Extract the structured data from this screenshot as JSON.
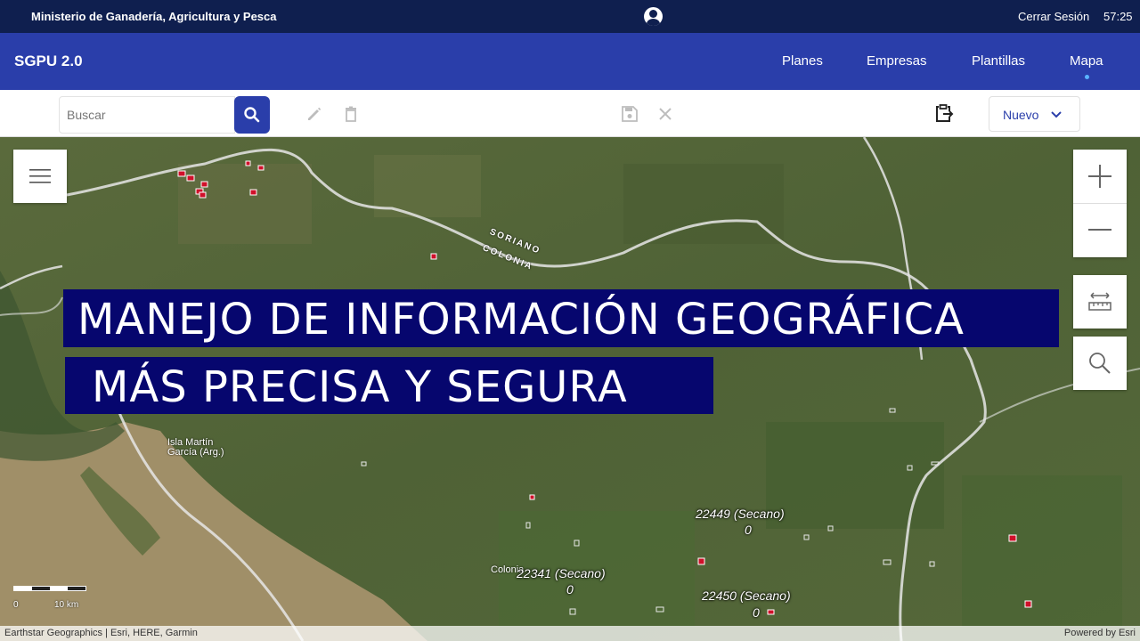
{
  "topbar": {
    "organization": "Ministerio de Ganadería, Agricultura y Pesca",
    "logout": "Cerrar Sesión",
    "clock": "57:25",
    "user_icon": "user-circle-icon"
  },
  "appbar": {
    "brand": "SGPU 2.0",
    "nav": [
      "Planes",
      "Empresas",
      "Plantillas",
      "Mapa"
    ],
    "active_nav": "Mapa"
  },
  "toolbar": {
    "search_placeholder": "Buscar",
    "icons": [
      "search-icon",
      "edit-icon",
      "delete-icon",
      "save-icon",
      "close-icon",
      "clipboard-icon",
      "chevron-down-icon"
    ],
    "new_label": "Nuevo"
  },
  "map": {
    "banner_line1": "MANEJO DE INFORMACIÓN GEOGRÁFICA",
    "banner_line2": "MÁS PRECISA Y SEGURA",
    "dept_soriano": "SORIANO",
    "dept_colonia": "COLONIA",
    "place_isla": "Isla Martín García (Arg.)",
    "place_colonia": "Colonia",
    "features": [
      {
        "label": "22449 (Secano)",
        "value": "0"
      },
      {
        "label": "22341 (Secano)",
        "value": "0"
      },
      {
        "label": "22450 (Secano)",
        "value": "0"
      }
    ],
    "scale_zero": "0",
    "scale_unit": "10 km",
    "controls": [
      "layers-icon",
      "zoom-in-icon",
      "zoom-out-icon",
      "measure-icon",
      "search-icon"
    ]
  },
  "attribution": {
    "left": "Earthstar Geographics | Esri, HERE, Garmin",
    "right": "Powered by Esri"
  },
  "colors": {
    "topbar": "#0f1f4f",
    "appbar": "#2a3eaa",
    "banner": "#06066e",
    "parcel": "#d0102a"
  }
}
